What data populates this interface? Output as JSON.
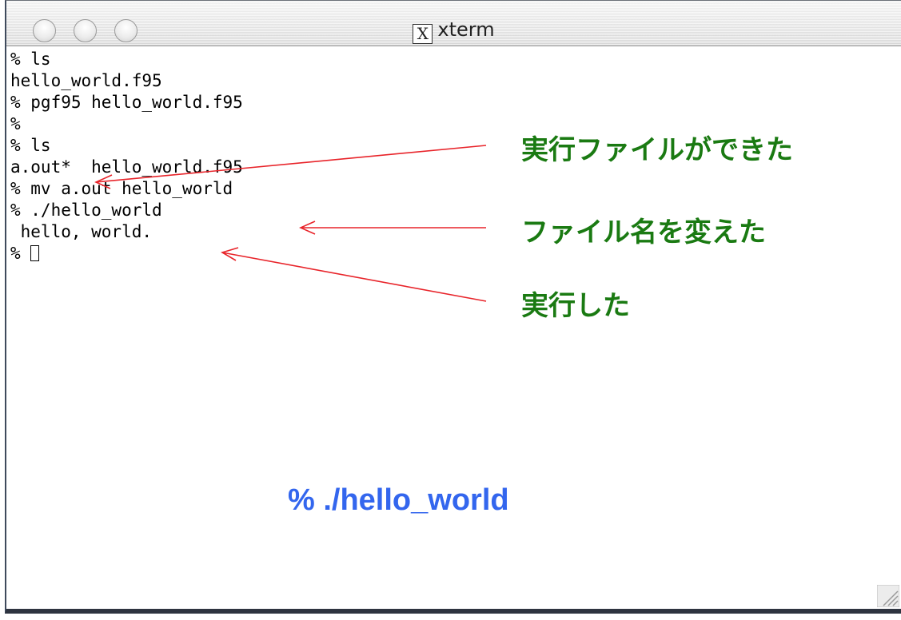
{
  "window": {
    "title": "xterm",
    "title_icon": "X"
  },
  "terminal": {
    "lines": [
      "% ls",
      "hello_world.f95",
      "% pgf95 hello_world.f95",
      "%",
      "% ls",
      "a.out*  hello_world.f95",
      "% mv a.out hello_world",
      "% ./hello_world",
      " hello, world.",
      "% "
    ]
  },
  "annotations": {
    "executable_created": "実行ファイルができた",
    "file_renamed": "ファイル名を変えた",
    "executed": "実行した"
  },
  "highlight_command": "% ./hello_world",
  "colors": {
    "annotation_text": "#1a7a12",
    "arrow": "#e8242a",
    "highlight": "#3366ee"
  },
  "icons": {
    "window_buttons": [
      "close-icon",
      "minimize-icon",
      "zoom-icon"
    ],
    "title_icon": "x11-icon",
    "resize": "resize-grip-icon"
  }
}
